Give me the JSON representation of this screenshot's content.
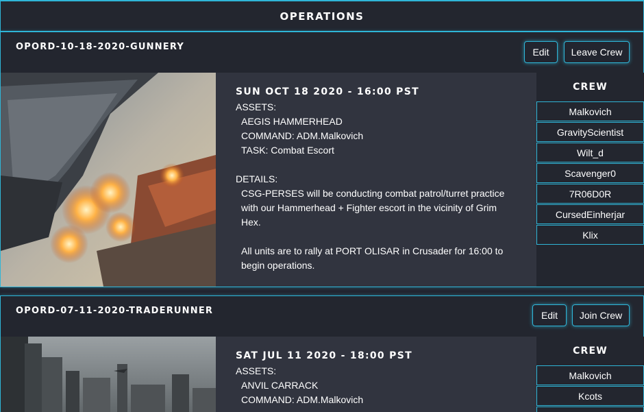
{
  "header": {
    "title": "OPERATIONS"
  },
  "operations": [
    {
      "name": "OPORD-10-18-2020-GUNNERY",
      "edit_label": "Edit",
      "crew_action_label": "Leave Crew",
      "date": "SUN OCT 18 2020 - 16:00 PST",
      "assets_label": "ASSETS:",
      "ship": "AEGIS HAMMERHEAD",
      "command": "COMMAND: ADM.Malkovich",
      "task": "TASK: Combat Escort",
      "details_label": "DETAILS:",
      "details_lines": [
        "CSG-PERSES will be conducting combat patrol/turret practice",
        "with our Hammerhead + Fighter escort in the vicinity of Grim",
        "Hex.",
        "",
        "All units are to rally at PORT OLISAR in Crusader for 16:00 to",
        "begin operations."
      ],
      "crew_title": "CREW",
      "crew": [
        "Malkovich",
        "GravityScientist",
        "Wilt_d",
        "Scavenger0",
        "7R06D0R",
        "CursedEinherjar",
        "Klix"
      ]
    },
    {
      "name": "OPORD-07-11-2020-TRADERUNNER",
      "edit_label": "Edit",
      "crew_action_label": "Join Crew",
      "date": "SAT JUL 11 2020 - 18:00 PST",
      "assets_label": "ASSETS:",
      "ship": "ANVIL CARRACK",
      "command": "COMMAND: ADM.Malkovich",
      "crew_title": "CREW",
      "crew": [
        "Malkovich",
        "Kcots"
      ]
    }
  ],
  "colors": {
    "accent": "#2fb6d8",
    "background": "#23262f",
    "panel": "#31343f"
  }
}
